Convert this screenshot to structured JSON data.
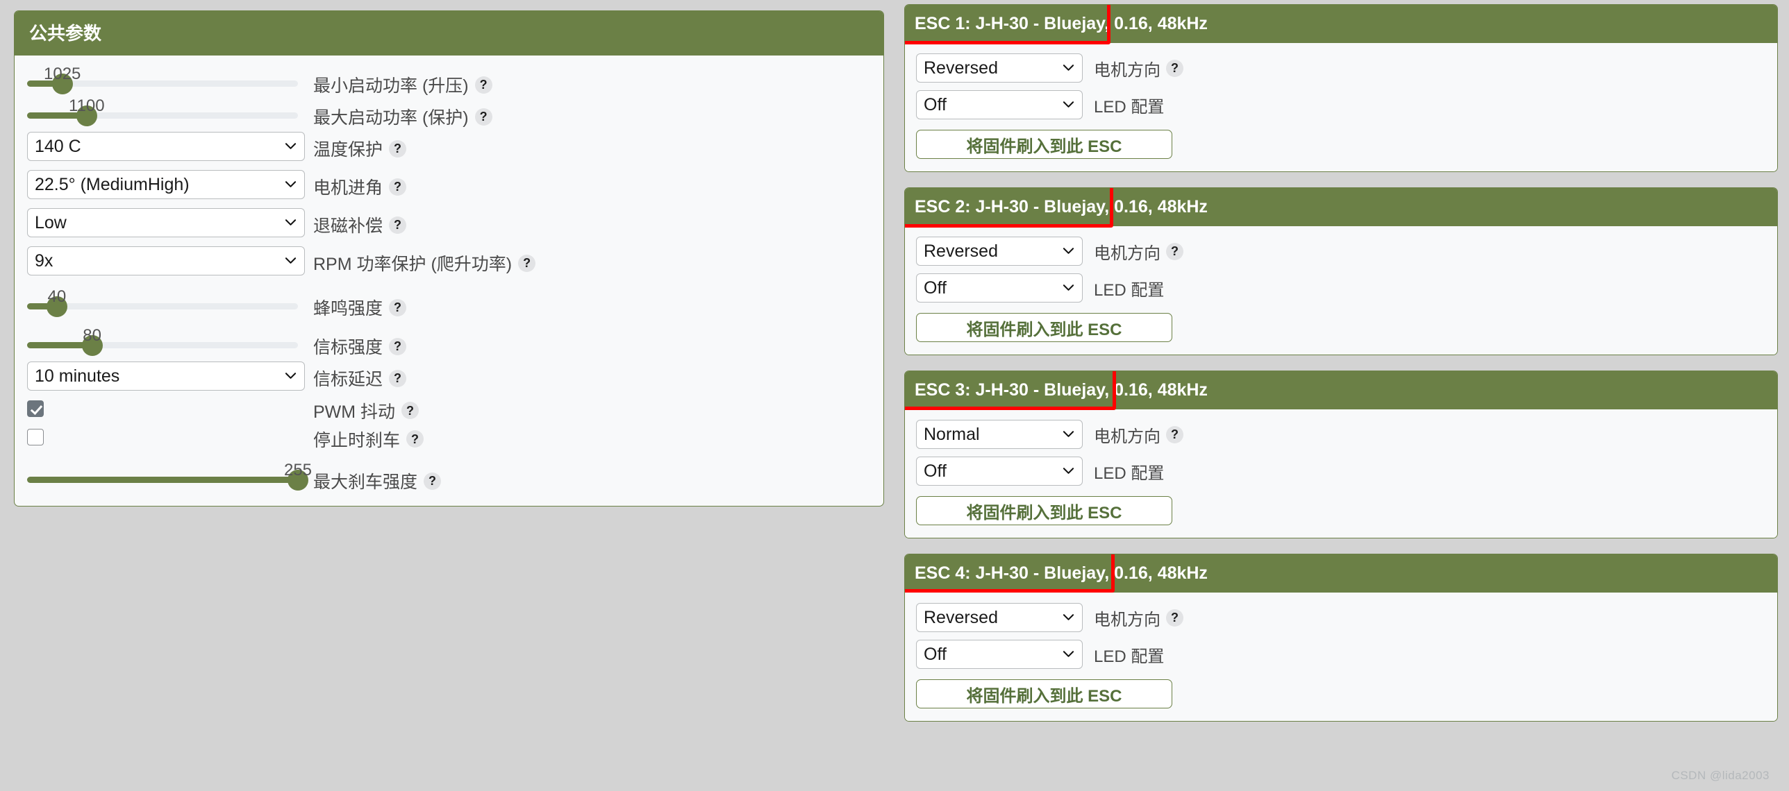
{
  "colors": {
    "brand_green": "#6b8046",
    "panel_bg": "#f8f9fa",
    "page_bg": "#d3d3d3",
    "annotation_red": "#ff0000",
    "button_text_green": "#55703a"
  },
  "common_panel": {
    "title": "公共参数",
    "rows": [
      {
        "type": "slider",
        "value": "1025",
        "percent": 13,
        "label": "最小启动功率 (升压)",
        "help": "?"
      },
      {
        "type": "slider",
        "value": "1100",
        "percent": 22,
        "label": "最大启动功率 (保护)",
        "help": "?"
      },
      {
        "type": "select",
        "value": "140 C",
        "label": "温度保护",
        "help": "?"
      },
      {
        "type": "select",
        "value": "22.5° (MediumHigh)",
        "label": "电机进角",
        "help": "?"
      },
      {
        "type": "select",
        "value": "Low",
        "label": "退磁补偿",
        "help": "?"
      },
      {
        "type": "select",
        "value": "9x",
        "label": "RPM 功率保护 (爬升功率)",
        "help": "?"
      },
      {
        "type": "slider",
        "value": "40",
        "percent": 11,
        "label": "蜂鸣强度",
        "help": "?"
      },
      {
        "type": "slider",
        "value": "80",
        "percent": 24,
        "label": "信标强度",
        "help": "?"
      },
      {
        "type": "select",
        "value": "10 minutes",
        "label": "信标延迟",
        "help": "?"
      },
      {
        "type": "checkbox",
        "checked": true,
        "label": "PWM 抖动",
        "help": "?"
      },
      {
        "type": "checkbox",
        "checked": false,
        "label": "停止时刹车",
        "help": "?"
      },
      {
        "type": "slider",
        "value": "255",
        "percent": 100,
        "label": "最大刹车强度",
        "help": "?"
      }
    ]
  },
  "esc_common": {
    "direction_label": "电机方向",
    "led_label": "LED 配置",
    "flash_button": "将固件刷入到此 ESC",
    "help": "?"
  },
  "esc_cards": [
    {
      "title": "ESC 1: J-H-30 - Bluejay, 0.16, 48kHz",
      "direction": "Reversed",
      "led": "Off"
    },
    {
      "title": "ESC 2: J-H-30 - Bluejay, 0.16, 48kHz",
      "direction": "Reversed",
      "led": "Off"
    },
    {
      "title": "ESC 3: J-H-30 - Bluejay, 0.16, 48kHz",
      "direction": "Normal",
      "led": "Off"
    },
    {
      "title": "ESC 4: J-H-30 - Bluejay, 0.16, 48kHz",
      "direction": "Reversed",
      "led": "Off"
    }
  ],
  "watermark": "CSDN @lida2003"
}
